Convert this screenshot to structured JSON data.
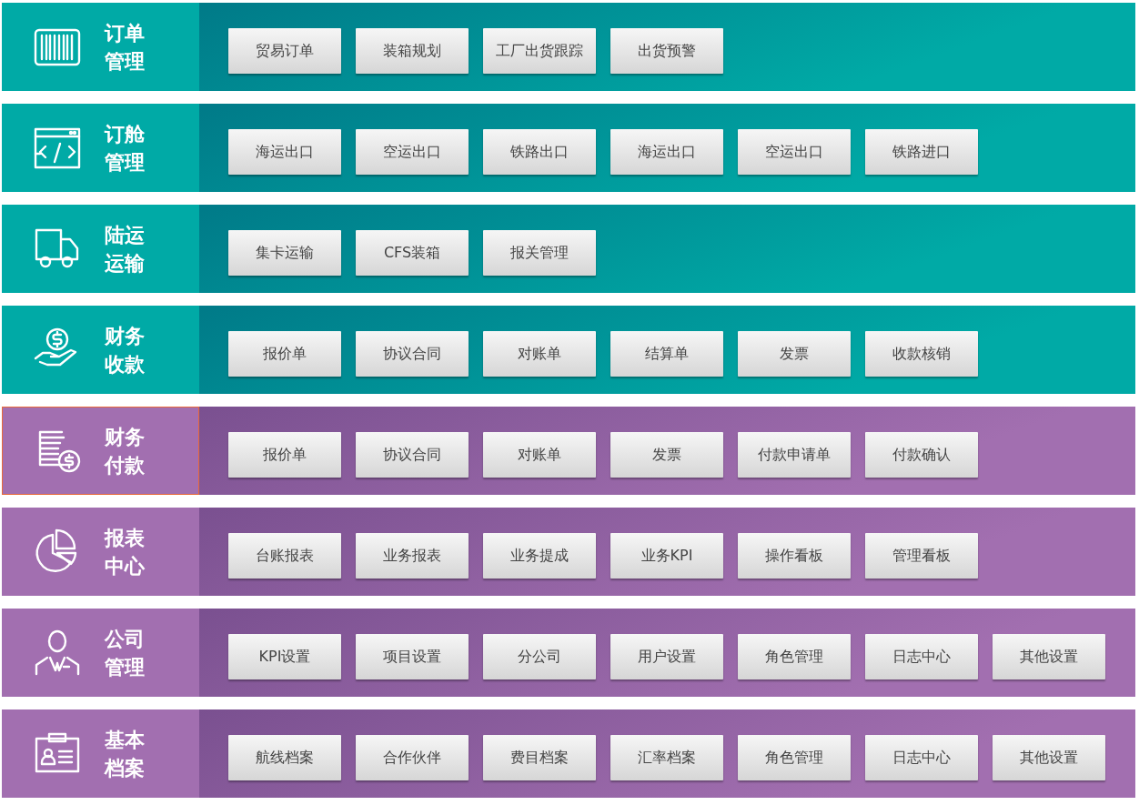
{
  "sections": [
    {
      "title": "订单管理",
      "color": "#00aaa6",
      "selected": false,
      "buttons": [
        "贸易订单",
        "装箱规划",
        "工厂出货跟踪",
        "出货预警"
      ]
    },
    {
      "title": "订舱管理",
      "color": "#00aaa6",
      "selected": false,
      "buttons": [
        "海运出口",
        "空运出口",
        "铁路出口",
        "海运出口",
        "空运出口",
        "铁路进口"
      ]
    },
    {
      "title": "陆运运输",
      "color": "#00aaa6",
      "selected": false,
      "buttons": [
        "集卡运输",
        "CFS装箱",
        "报关管理"
      ]
    },
    {
      "title": "财务收款",
      "color": "#00aaa6",
      "selected": false,
      "buttons": [
        "报价单",
        "协议合同",
        "对账单",
        "结算单",
        "发票",
        "收款核销"
      ]
    },
    {
      "title": "财务付款",
      "color": "#a26fb0",
      "selected": true,
      "buttons": [
        "报价单",
        "协议合同",
        "对账单",
        "发票",
        "付款申请单",
        "付款确认"
      ]
    },
    {
      "title": "报表中心",
      "color": "#a26fb0",
      "selected": false,
      "buttons": [
        "台账报表",
        "业务报表",
        "业务提成",
        "业务KPI",
        "操作看板",
        "管理看板"
      ]
    },
    {
      "title": "公司管理",
      "color": "#a26fb0",
      "selected": false,
      "buttons": [
        "KPI设置",
        "项目设置",
        "分公司",
        "用户设置",
        "角色管理",
        "日志中心",
        "其他设置"
      ]
    },
    {
      "title": "基本档案",
      "color": "#a26fb0",
      "selected": false,
      "buttons": [
        "航线档案",
        "合作伙伴",
        "费目档案",
        "汇率档案",
        "角色管理",
        "日志中心",
        "其他设置"
      ]
    }
  ]
}
